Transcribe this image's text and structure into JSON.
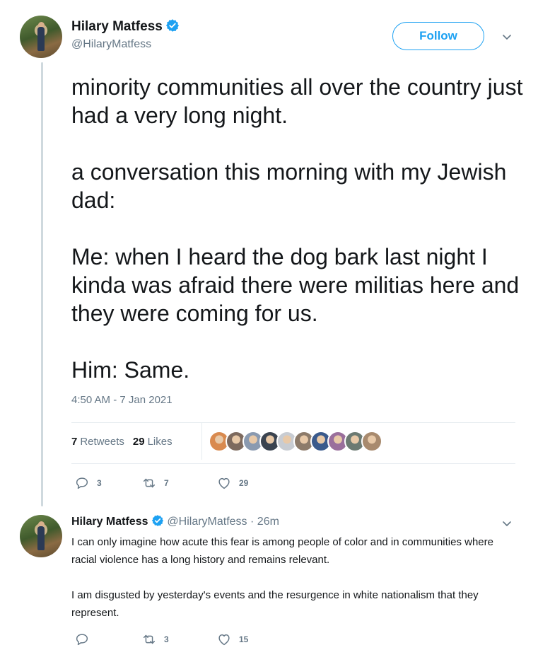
{
  "tweet": {
    "author_name": "Hilary Matfess",
    "author_handle": "@HilaryMatfess",
    "follow_label": "Follow",
    "paragraphs": [
      "minority communities all over the country just had a very long night.",
      "a conversation this morning with my Jewish dad:",
      "Me:  when I heard the dog bark last night I kinda was afraid there were militias here and they were coming for us.",
      "Him: Same."
    ],
    "timestamp": "4:50 AM - 7 Jan 2021",
    "retweets_count": "7",
    "retweets_label": "Retweets",
    "likes_count": "29",
    "likes_label": "Likes",
    "reply_count": "3",
    "retweet_action_count": "7",
    "like_action_count": "29",
    "liker_avatar_colors": [
      "#d98a4f",
      "#7d6a5e",
      "#8a9ab0",
      "#3b4450",
      "#c8ccd2",
      "#8d7b6a",
      "#3a5a8c",
      "#9a6f9c",
      "#6c7a72",
      "#a88a6e"
    ]
  },
  "reply": {
    "author_name": "Hilary Matfess",
    "author_handle": "@HilaryMatfess",
    "separator": "·",
    "time": "26m",
    "paragraphs": [
      "I can only imagine how acute this fear is among people of color and in communities where racial violence has a long history and remains relevant.",
      "I am disgusted by yesterday's events and the resurgence in white nationalism that they represent."
    ],
    "reply_count": "",
    "retweet_count": "3",
    "like_count": "15"
  },
  "colors": {
    "accent": "#1da1f2",
    "muted": "#657786",
    "text": "#14171a",
    "divider": "#e6ecf0"
  },
  "icons": [
    "verified-badge-icon",
    "chevron-down-icon",
    "reply-icon",
    "retweet-icon",
    "heart-icon"
  ]
}
